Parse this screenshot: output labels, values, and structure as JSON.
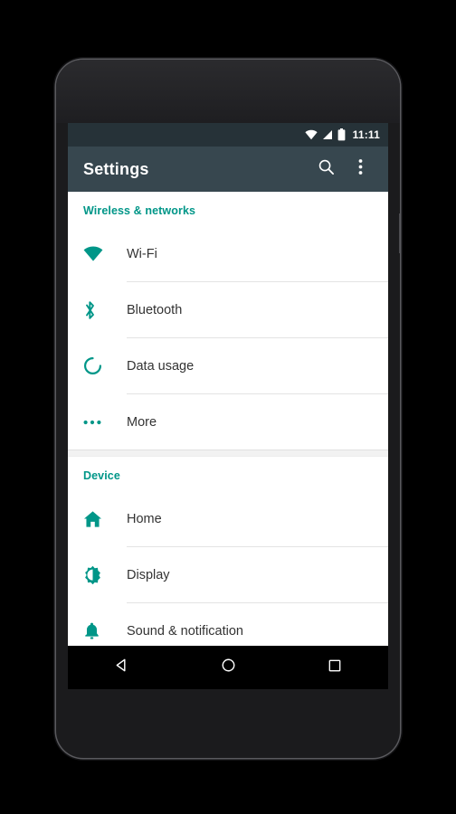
{
  "device": {
    "front_camera": "front-camera",
    "earpiece": "earpiece-speaker",
    "bottom_speaker": "bottom-speaker",
    "power_button": "power-button"
  },
  "status_bar": {
    "time": "11:11",
    "icons": [
      "wifi-icon",
      "cellular-signal-icon",
      "battery-icon"
    ],
    "background": "#263238"
  },
  "app_bar": {
    "title": "Settings",
    "background": "#37474f",
    "actions": [
      {
        "name": "search-button",
        "icon": "search-icon"
      },
      {
        "name": "overflow-menu-button",
        "icon": "more-vert-icon"
      }
    ]
  },
  "accent_color": "#009688",
  "groups": [
    {
      "header": "Wireless & networks",
      "items": [
        {
          "label": "Wi-Fi",
          "icon": "wifi-icon"
        },
        {
          "label": "Bluetooth",
          "icon": "bluetooth-icon"
        },
        {
          "label": "Data usage",
          "icon": "data-usage-icon"
        },
        {
          "label": "More",
          "icon": "more-horiz-icon"
        }
      ]
    },
    {
      "header": "Device",
      "items": [
        {
          "label": "Home",
          "icon": "home-icon"
        },
        {
          "label": "Display",
          "icon": "brightness-icon"
        },
        {
          "label": "Sound & notification",
          "icon": "bell-icon"
        }
      ]
    }
  ],
  "nav_bar": {
    "buttons": [
      {
        "name": "back-button",
        "icon": "back-triangle-icon"
      },
      {
        "name": "home-button",
        "icon": "home-circle-icon"
      },
      {
        "name": "recents-button",
        "icon": "recents-square-icon"
      }
    ]
  }
}
